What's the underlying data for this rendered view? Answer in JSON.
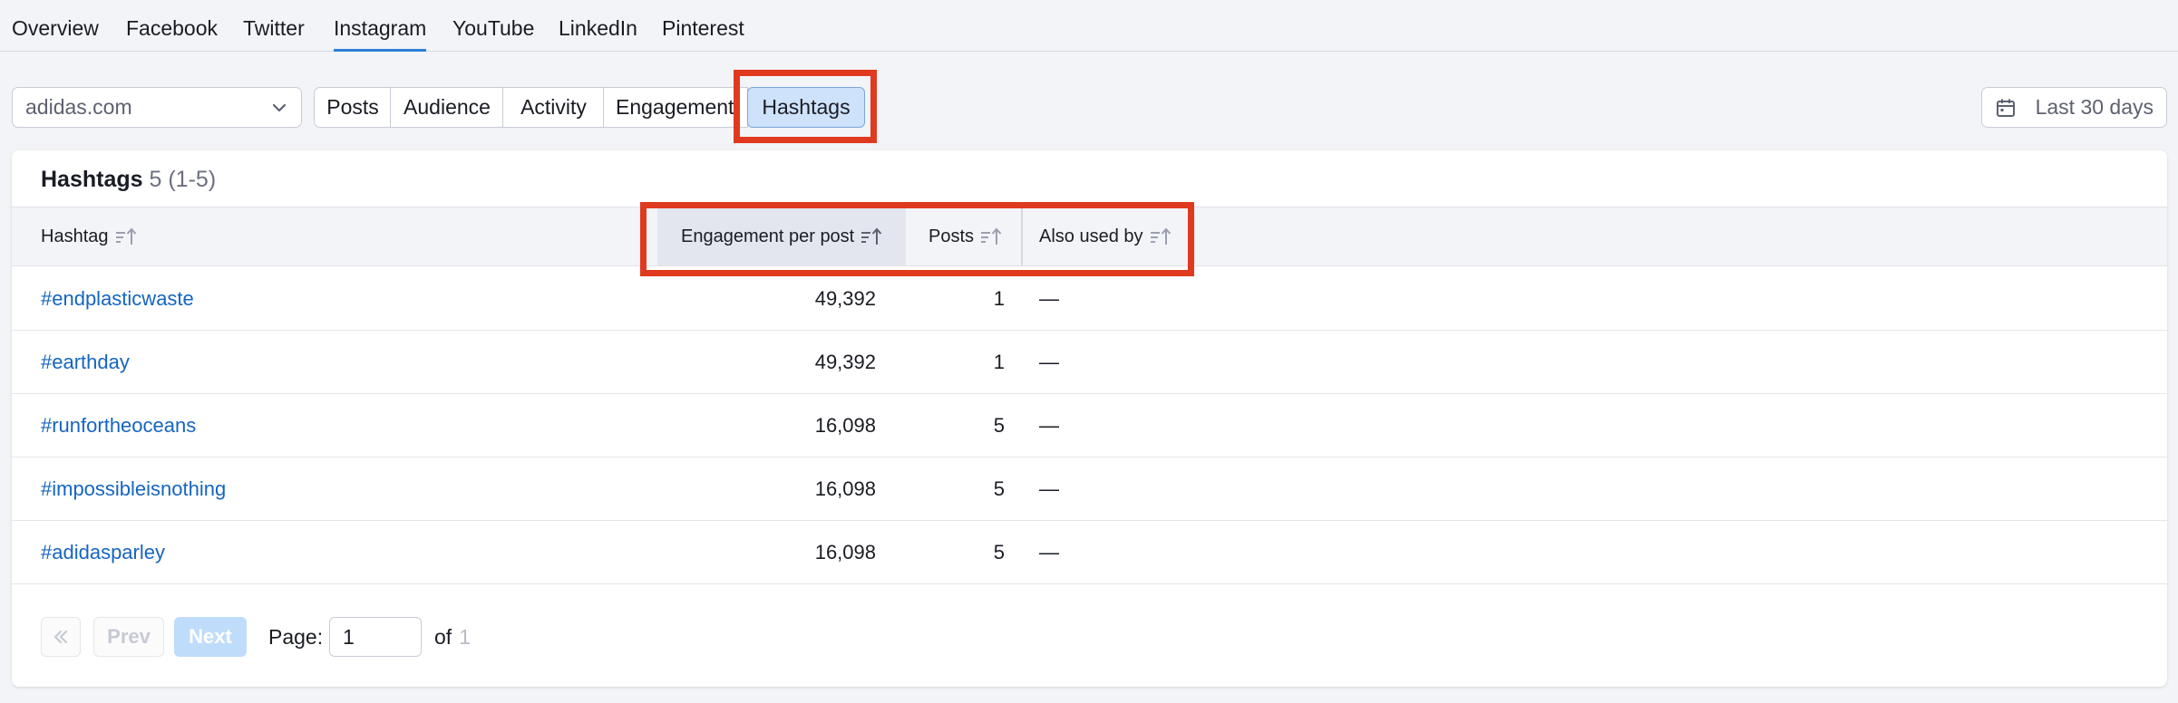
{
  "nav": {
    "tabs": [
      "Overview",
      "Facebook",
      "Twitter",
      "Instagram",
      "YouTube",
      "LinkedIn",
      "Pinterest"
    ],
    "active": "Instagram"
  },
  "toolbar": {
    "domain": "adidas.com",
    "segments": [
      "Posts",
      "Audience",
      "Activity",
      "Engagement",
      "Hashtags"
    ],
    "active_segment": "Hashtags",
    "date_range": "Last 30 days"
  },
  "table": {
    "title": "Hashtags",
    "count": "5",
    "range": "(1-5)",
    "columns": [
      "Hashtag",
      "Engagement per post",
      "Posts",
      "Also used by"
    ],
    "rows": [
      {
        "hashtag": "#endplasticwaste",
        "engagement": "49,392",
        "posts": "1",
        "also_used_by": "—"
      },
      {
        "hashtag": "#earthday",
        "engagement": "49,392",
        "posts": "1",
        "also_used_by": "—"
      },
      {
        "hashtag": "#runfortheoceans",
        "engagement": "16,098",
        "posts": "5",
        "also_used_by": "—"
      },
      {
        "hashtag": "#impossibleisnothing",
        "engagement": "16,098",
        "posts": "5",
        "also_used_by": "—"
      },
      {
        "hashtag": "#adidasparley",
        "engagement": "16,098",
        "posts": "5",
        "also_used_by": "—"
      }
    ]
  },
  "pagination": {
    "first_icon": "double-chevron-left-icon",
    "prev": "Prev",
    "next": "Next",
    "page_label": "Page:",
    "page_value": "1",
    "of_label": "of",
    "total_pages": "1"
  },
  "colors": {
    "accent": "#2d7fd7",
    "link": "#1565c0",
    "highlight": "#e03a1e",
    "active_segment_bg": "#cfe2fb"
  }
}
